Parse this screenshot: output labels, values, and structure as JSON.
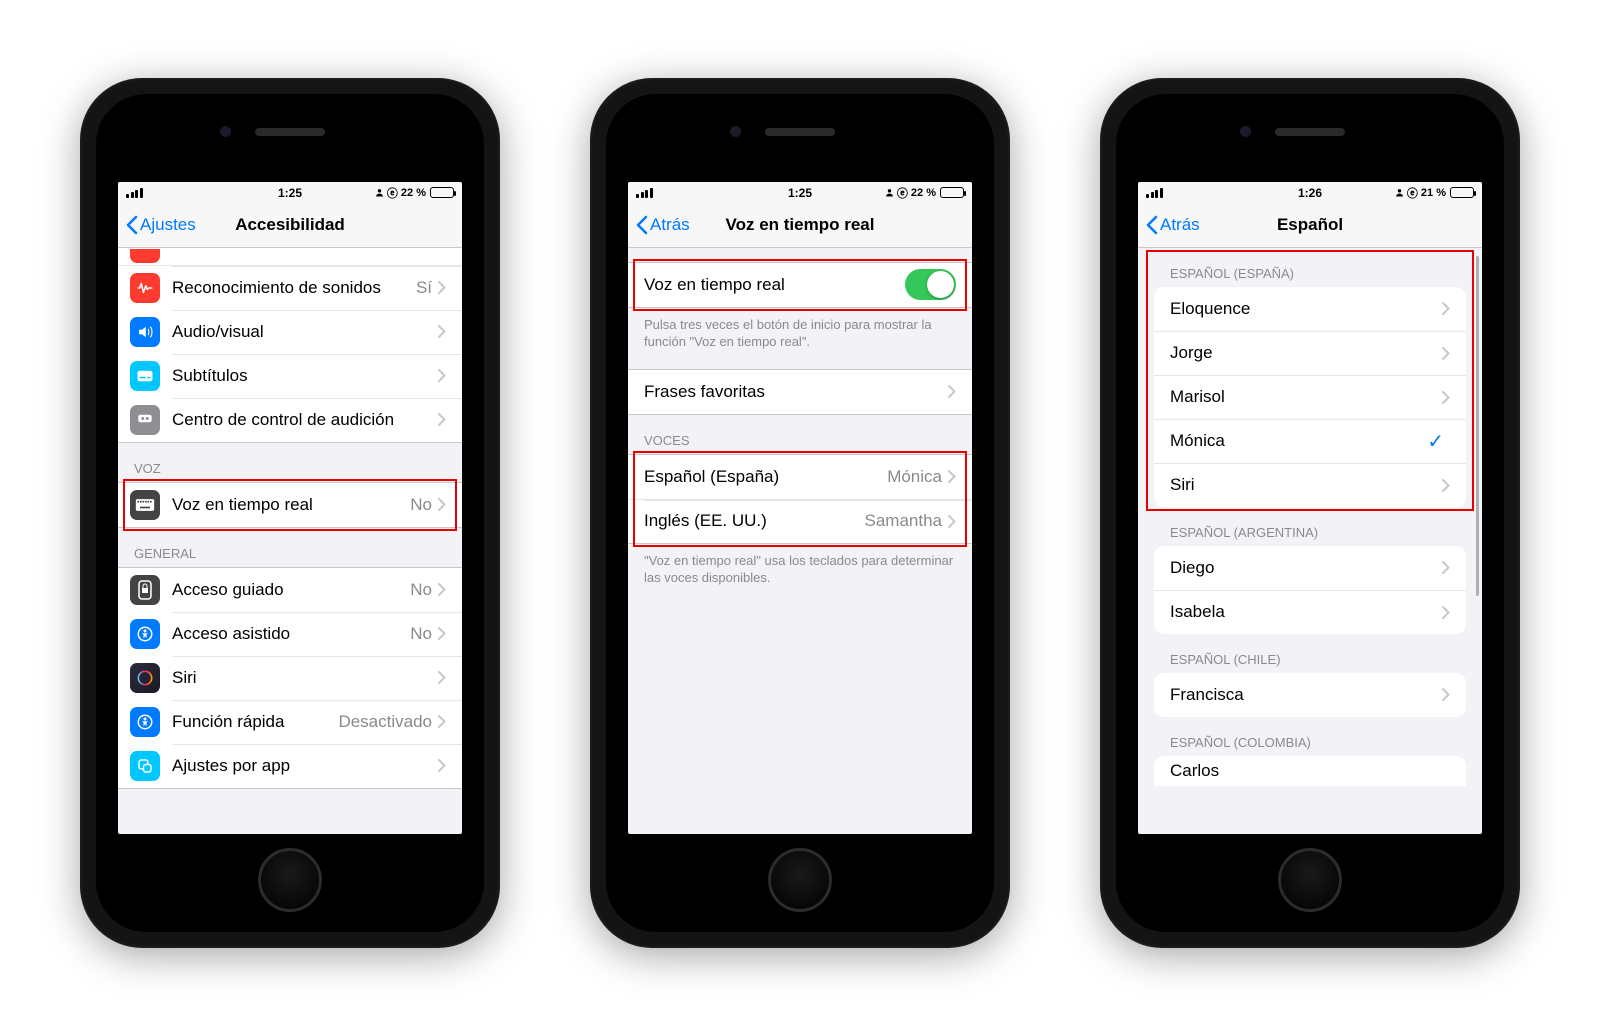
{
  "phone1": {
    "status": {
      "time": "1:25",
      "battery_text": "22 %"
    },
    "nav": {
      "back": "Ajustes",
      "title": "Accesibilidad"
    },
    "hearing": {
      "items": [
        {
          "label": "Reconocimiento de sonidos",
          "detail": "Sí"
        },
        {
          "label": "Audio/visual"
        },
        {
          "label": "Subtítulos"
        },
        {
          "label": "Centro de control de audición"
        }
      ]
    },
    "voice": {
      "header": "VOZ",
      "item": {
        "label": "Voz en tiempo real",
        "detail": "No"
      }
    },
    "general": {
      "header": "GENERAL",
      "items": [
        {
          "label": "Acceso guiado",
          "detail": "No"
        },
        {
          "label": "Acceso asistido",
          "detail": "No"
        },
        {
          "label": "Siri"
        },
        {
          "label": "Función rápida",
          "detail": "Desactivado"
        },
        {
          "label": "Ajustes por app"
        }
      ]
    }
  },
  "phone2": {
    "status": {
      "time": "1:25",
      "battery_text": "22 %"
    },
    "nav": {
      "back": "Atrás",
      "title": "Voz en tiempo real"
    },
    "toggle": {
      "label": "Voz en tiempo real",
      "on": true
    },
    "footer1": "Pulsa tres veces el botón de inicio para mostrar la función \"Voz en tiempo real\".",
    "favorites": {
      "label": "Frases favoritas"
    },
    "voices": {
      "header": "VOCES",
      "items": [
        {
          "label": "Español (España)",
          "detail": "Mónica"
        },
        {
          "label": "Inglés (EE. UU.)",
          "detail": "Samantha"
        }
      ]
    },
    "footer2": "\"Voz en tiempo real\" usa los teclados para determinar las voces disponibles."
  },
  "phone3": {
    "status": {
      "time": "1:26",
      "battery_text": "21 %"
    },
    "nav": {
      "back": "Atrás",
      "title": "Español"
    },
    "sections": [
      {
        "header": "ESPAÑOL (ESPAÑA)",
        "items": [
          {
            "label": "Eloquence"
          },
          {
            "label": "Jorge"
          },
          {
            "label": "Marisol"
          },
          {
            "label": "Mónica",
            "selected": true
          },
          {
            "label": "Siri"
          }
        ]
      },
      {
        "header": "ESPAÑOL (ARGENTINA)",
        "items": [
          {
            "label": "Diego"
          },
          {
            "label": "Isabela"
          }
        ]
      },
      {
        "header": "ESPAÑOL (CHILE)",
        "items": [
          {
            "label": "Francisca"
          }
        ]
      },
      {
        "header": "ESPAÑOL (COLOMBIA)",
        "items": [
          {
            "label": "Carlos"
          }
        ]
      }
    ]
  }
}
